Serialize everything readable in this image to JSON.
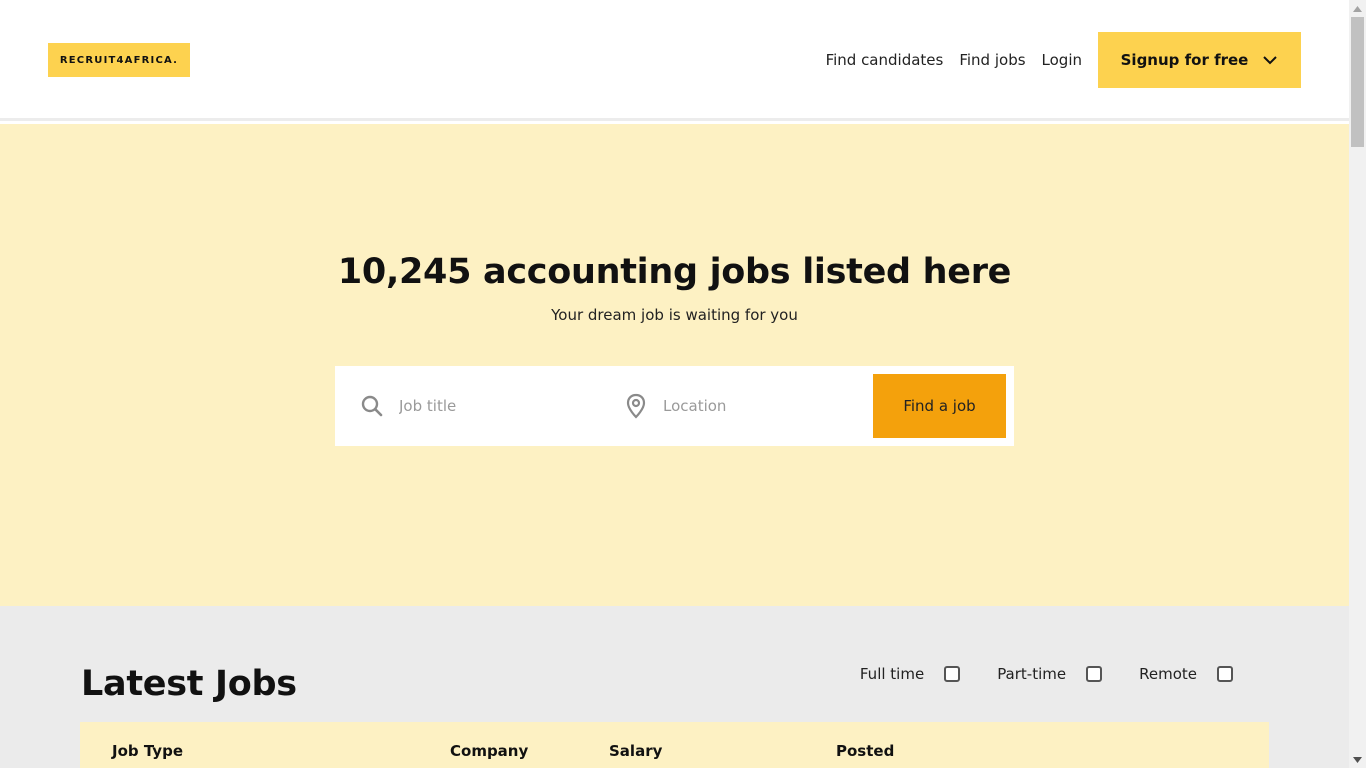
{
  "header": {
    "logo": "RECRUIT4AFRICA.",
    "nav": {
      "find_candidates": "Find candidates",
      "find_jobs": "Find jobs",
      "login": "Login",
      "signup": "Signup for free"
    }
  },
  "hero": {
    "title": "10,245 accounting jobs listed here",
    "subtitle": "Your dream job is waiting for you",
    "search": {
      "job_title_placeholder": "Job title",
      "location_placeholder": "Location",
      "button": "Find a job"
    }
  },
  "latest": {
    "heading": "Latest Jobs",
    "filters": [
      "Full time",
      "Part-time",
      "Remote"
    ],
    "columns": [
      "Job Type",
      "Company",
      "Salary",
      "Posted"
    ]
  },
  "colors": {
    "brand_yellow": "#fdd24f",
    "hero_bg": "#fdf1c3",
    "cta_orange": "#f4a10c",
    "section_gray": "#ebebeb"
  },
  "icons": {
    "search": "search-icon",
    "location": "map-pin-icon",
    "chevron": "chevron-down-icon"
  }
}
